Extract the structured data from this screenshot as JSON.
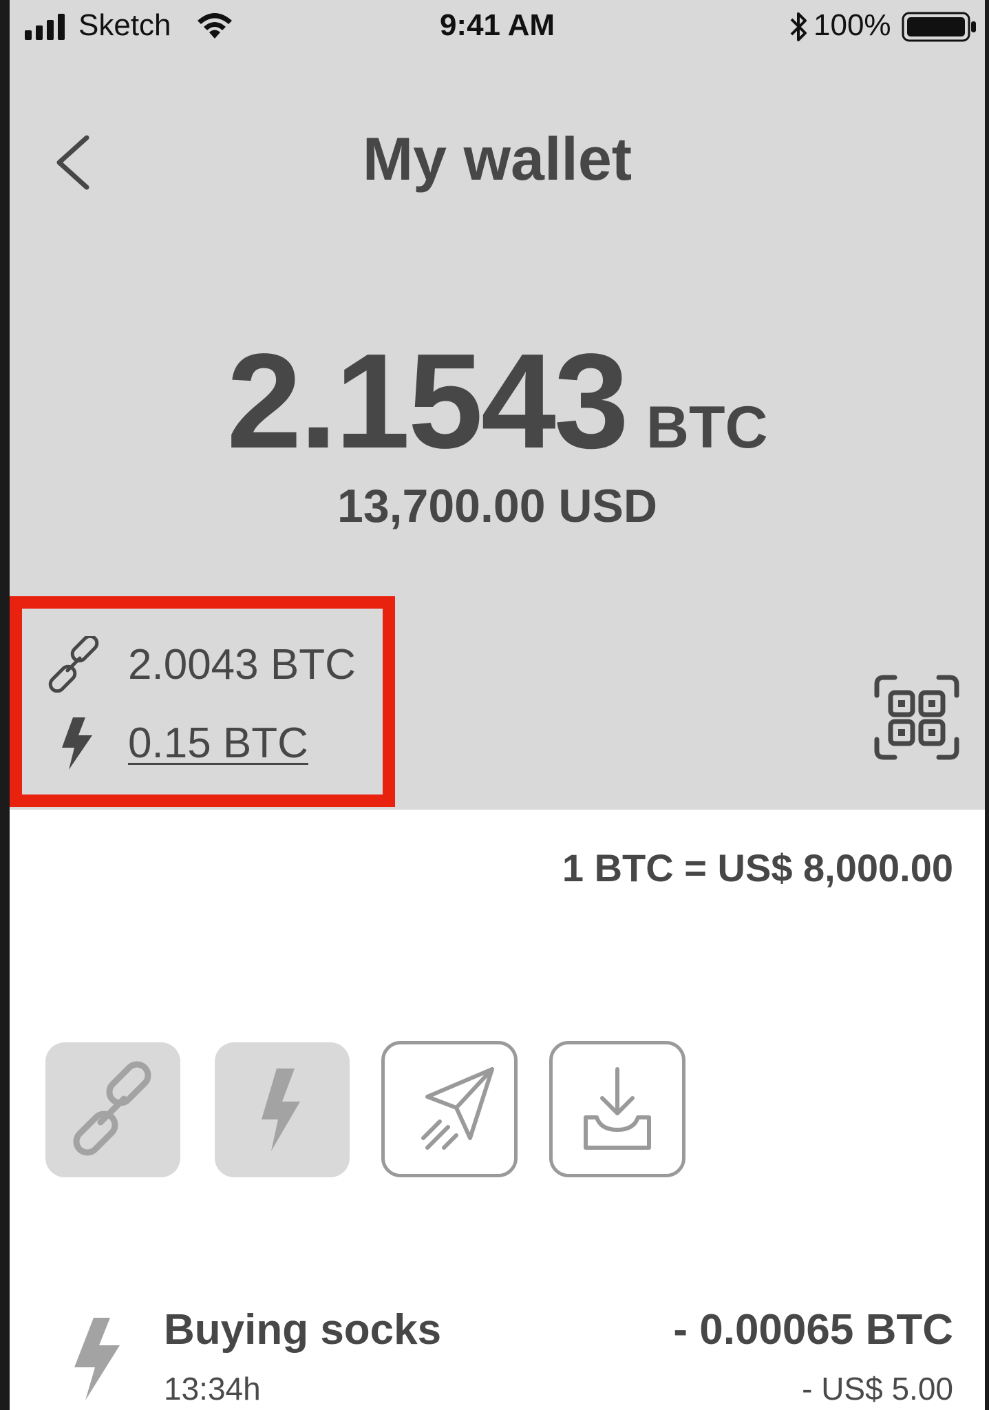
{
  "status_bar": {
    "carrier": "Sketch",
    "time": "9:41 AM",
    "battery": "100%"
  },
  "header": {
    "title": "My wallet"
  },
  "balance": {
    "amount": "2.1543",
    "unit": "BTC",
    "fiat": "13,700.00 USD"
  },
  "sub_balances": {
    "onchain": "2.0043 BTC",
    "lightning": "0.15 BTC",
    "highlight_color": "#e8220f"
  },
  "exchange_rate": "1 BTC = US$ 8,000.00",
  "actions": [
    {
      "icon": "chain-link-icon"
    },
    {
      "icon": "lightning-bolt-icon"
    },
    {
      "icon": "paper-plane-send-icon"
    },
    {
      "icon": "download-tray-icon"
    }
  ],
  "transactions": [
    {
      "title": "Buying socks",
      "time": "13:34h",
      "amount": "- 0.00065 BTC",
      "fiat": "- US$ 5.00",
      "icon": "lightning-bolt-icon"
    }
  ],
  "colors": {
    "header_bg": "#d9d9d9",
    "text": "#474747",
    "icon_gray": "#9a9a9a"
  }
}
